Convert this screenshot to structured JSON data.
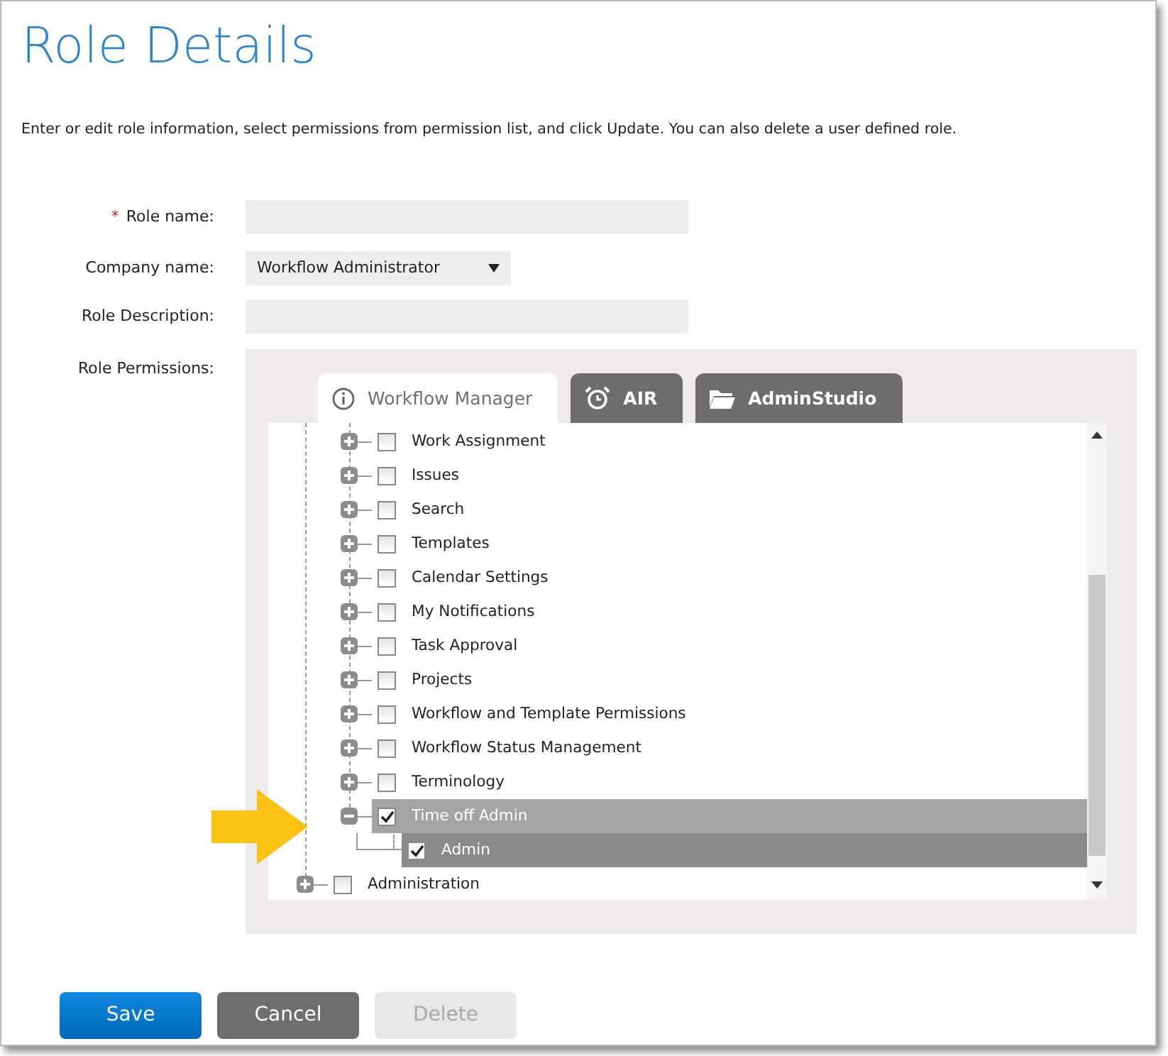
{
  "title": "Role Details",
  "description": "Enter or edit role information, select permissions from permission list, and click Update. You can also delete a user defined role.",
  "form": {
    "role_name": {
      "label": "Role name:",
      "required_mark": "*"
    },
    "company_name": {
      "label": "Company name:",
      "value": "Workflow Administrator"
    },
    "role_description": {
      "label": "Role Description:"
    },
    "role_permissions": {
      "label": "Role Permissions:"
    }
  },
  "tabs": [
    {
      "label": "Workflow Manager",
      "selected": true
    },
    {
      "label": "AIR",
      "selected": false
    },
    {
      "label": "AdminStudio",
      "selected": false
    }
  ],
  "tree": [
    {
      "children": [
        {
          "label": "Work Assignment",
          "checked": false,
          "expanded": false,
          "highlighted": false,
          "selected": false,
          "has_children": true
        },
        {
          "label": "Issues",
          "checked": false,
          "expanded": false,
          "highlighted": false,
          "selected": false,
          "has_children": true
        },
        {
          "label": "Search",
          "checked": false,
          "expanded": false,
          "highlighted": false,
          "selected": false,
          "has_children": true
        },
        {
          "label": "Templates",
          "checked": false,
          "expanded": false,
          "highlighted": false,
          "selected": false,
          "has_children": true
        },
        {
          "label": "Calendar Settings",
          "checked": false,
          "expanded": false,
          "highlighted": false,
          "selected": false,
          "has_children": true
        },
        {
          "label": "My Notifications",
          "checked": false,
          "expanded": false,
          "highlighted": false,
          "selected": false,
          "has_children": true
        },
        {
          "label": "Task Approval",
          "checked": false,
          "expanded": false,
          "highlighted": false,
          "selected": false,
          "has_children": true
        },
        {
          "label": "Projects",
          "checked": false,
          "expanded": false,
          "highlighted": false,
          "selected": false,
          "has_children": true
        },
        {
          "label": "Workflow and Template Permissions",
          "checked": false,
          "expanded": false,
          "highlighted": false,
          "selected": false,
          "has_children": true
        },
        {
          "label": "Workflow Status Management",
          "checked": false,
          "expanded": false,
          "highlighted": false,
          "selected": false,
          "has_children": true
        },
        {
          "label": "Terminology",
          "checked": false,
          "expanded": false,
          "highlighted": false,
          "selected": false,
          "has_children": true
        },
        {
          "label": "Time off Admin",
          "checked": true,
          "expanded": true,
          "highlighted": true,
          "selected": false,
          "has_children": true,
          "children": [
            {
              "label": "Admin",
              "checked": true,
              "highlighted": false,
              "selected": true,
              "has_children": false
            }
          ]
        }
      ]
    },
    {
      "label": "Administration",
      "checked": false,
      "expanded": false,
      "highlighted": false,
      "selected": false,
      "has_children": true
    }
  ],
  "buttons": [
    {
      "label": "Save",
      "kind": "primary",
      "disabled": false
    },
    {
      "label": "Cancel",
      "kind": "secondary",
      "disabled": false
    },
    {
      "label": "Delete",
      "kind": "secondary",
      "disabled": true
    }
  ]
}
